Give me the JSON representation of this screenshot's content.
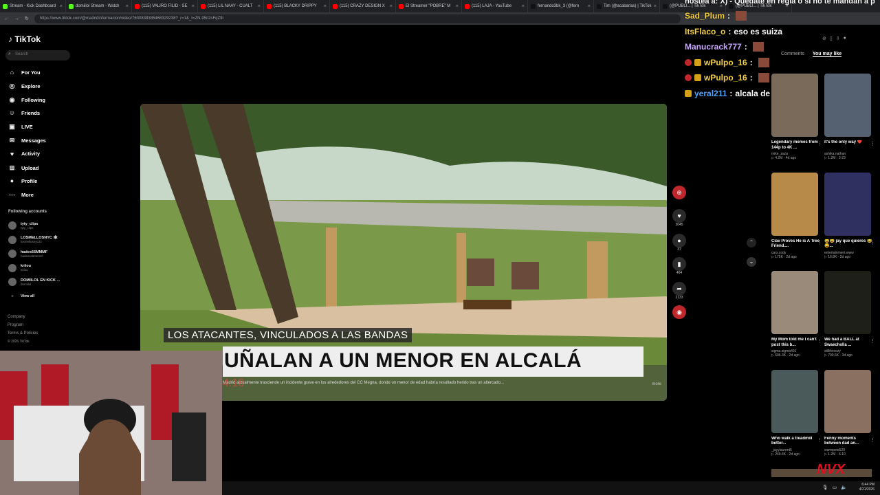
{
  "browser": {
    "tabs": [
      {
        "title": "Stream - Kick Dashboard",
        "color": "#53fc18"
      },
      {
        "title": "domiilol Stream - Watch",
        "color": "#53fc18"
      },
      {
        "title": "(115) VALIRO FILID - SE",
        "color": "#ff0000"
      },
      {
        "title": "(115) LIL NAAY - CUALT",
        "color": "#ff0000"
      },
      {
        "title": "(115) BLACKY DRIPPY",
        "color": "#ff0000"
      },
      {
        "title": "(115) CRAZY DESIGN X",
        "color": "#ff0000"
      },
      {
        "title": "El Streamer \"POBRE\" M",
        "color": "#ff0000"
      },
      {
        "title": "(115) LAJA - YouTube",
        "color": "#ff0000"
      },
      {
        "title": "fernando3bk_3 (@fern",
        "color": "#111111"
      },
      {
        "title": "Tim (@acabarlas) | TikTok",
        "color": "#111111"
      },
      {
        "title": "(@PUBLI... | TikTok",
        "color": "#111111"
      },
      {
        "title": "(@PUBLI... | TikTok",
        "color": "#111111"
      }
    ],
    "url": "https://www.tiktok.com/@madridinformacion/video/7630838385468329238?_r=1&_t=ZN-95iI2sFqZ9i"
  },
  "sidebar": {
    "logo": "TikTok",
    "search_placeholder": "Search",
    "nav": [
      {
        "label": "For You",
        "icon": "home-icon"
      },
      {
        "label": "Explore",
        "icon": "compass-icon"
      },
      {
        "label": "Following",
        "icon": "following-icon"
      },
      {
        "label": "Friends",
        "icon": "friends-icon"
      },
      {
        "label": "LIVE",
        "icon": "live-icon"
      },
      {
        "label": "Messages",
        "icon": "messages-icon"
      },
      {
        "label": "Activity",
        "icon": "activity-icon"
      },
      {
        "label": "Upload",
        "icon": "upload-icon"
      },
      {
        "label": "Profile",
        "icon": "profile-icon"
      },
      {
        "label": "More",
        "icon": "more-icon"
      }
    ],
    "following_title": "Following accounts",
    "accounts": [
      {
        "name": "tyty_clips",
        "sub": "tyty_clips"
      },
      {
        "name": "LOSMELLOSNYC 🕸",
        "sub": "losmellosnyc22"
      },
      {
        "name": "hades66MMMF",
        "sub": "hadesss6mmmf"
      },
      {
        "name": "kriiou",
        "sub": "kriiou"
      },
      {
        "name": "DOMIILOL EN KICK ...",
        "sub": "domiilol"
      }
    ],
    "view_all": "View all",
    "footer": [
      "Company",
      "Program",
      "Terms & Policies",
      "© 2026 TikTok"
    ]
  },
  "video": {
    "lower_third_top": "LOS ATACANTES, VINCULADOS A LAS BANDAS",
    "lower_third_main": "UÑALAN A UN MENOR EN ALCALÁ",
    "caption": "Madrid actualmente trasciende un incidente grave en los alrededores del CC Megna, donde un menor de edad habría resultado herido tras un altercado...",
    "more": "more",
    "time_overlay": "4:18"
  },
  "actions": {
    "likes": "3045",
    "comments": "37",
    "saves": "464",
    "shares": "2133"
  },
  "chat": [
    {
      "user": "Sad_Plum",
      "message": "",
      "color": "#f4d03f"
    },
    {
      "user": "ItsFlaco_o",
      "message": "eso es suiza",
      "color": "#f4d03f"
    },
    {
      "user": "Manucrack777",
      "message": "",
      "color": "#c9a6ff"
    },
    {
      "user": "wPulpo_16",
      "message": "",
      "color": "#f4d03f"
    },
    {
      "user": "wPulpo_16",
      "message": "",
      "color": "#f4d03f"
    },
    {
      "user": "yeral211",
      "message": "alcala de henares",
      "color": "#4aa3ff"
    }
  ],
  "chat_top_overflow": "hostea a: X) - Quedate en regla o si no te mandan a p",
  "right_panel": {
    "tabs": [
      "Comments",
      "You may like"
    ],
    "cards": [
      {
        "title": "Legendary memes from 144p to 4K ...",
        "user": "mike_zaza",
        "views": "4.2M",
        "date": "4d ago",
        "color": "#7a6a5a"
      },
      {
        "title": "it's the only way ❤️",
        "user": "ashika.nathan",
        "views": "1.2M",
        "date": "3-23",
        "color": "#556070"
      },
      {
        "title": "Clav Proves He is A Tree Friend....",
        "user": "cars.cody",
        "views": "175K",
        "date": "2d ago",
        "color": "#b88a4a"
      },
      {
        "title": "😂😂 jay que quieres 😂😂...",
        "user": "entertainment.www",
        "views": "16.8K",
        "date": "2d ago",
        "color": "#303060"
      },
      {
        "title": "My Mom told me I can't post this b...",
        "user": "sigma.sigma491",
        "views": "606.3K",
        "date": "2d ago",
        "color": "#9a8a7a"
      },
      {
        "title": "We had a BALL at Swaecholla ...",
        "user": "stillrbreezy",
        "views": "700.6K",
        "date": "3d ago",
        "color": "#1f1f1a"
      },
      {
        "title": "Who walk a treadmill better...",
        "user": "_jayylaurent5",
        "views": "249.4K",
        "date": "2d ago",
        "color": "#4a5a5a"
      },
      {
        "title": "Fenny moments between dad an...",
        "user": "warmpets520",
        "views": "1.2M",
        "date": "3-10",
        "color": "#8a7060"
      }
    ]
  },
  "taskbar": {
    "time": "6:44 PM",
    "date": "4/21/2026"
  },
  "watermark": "NVX"
}
